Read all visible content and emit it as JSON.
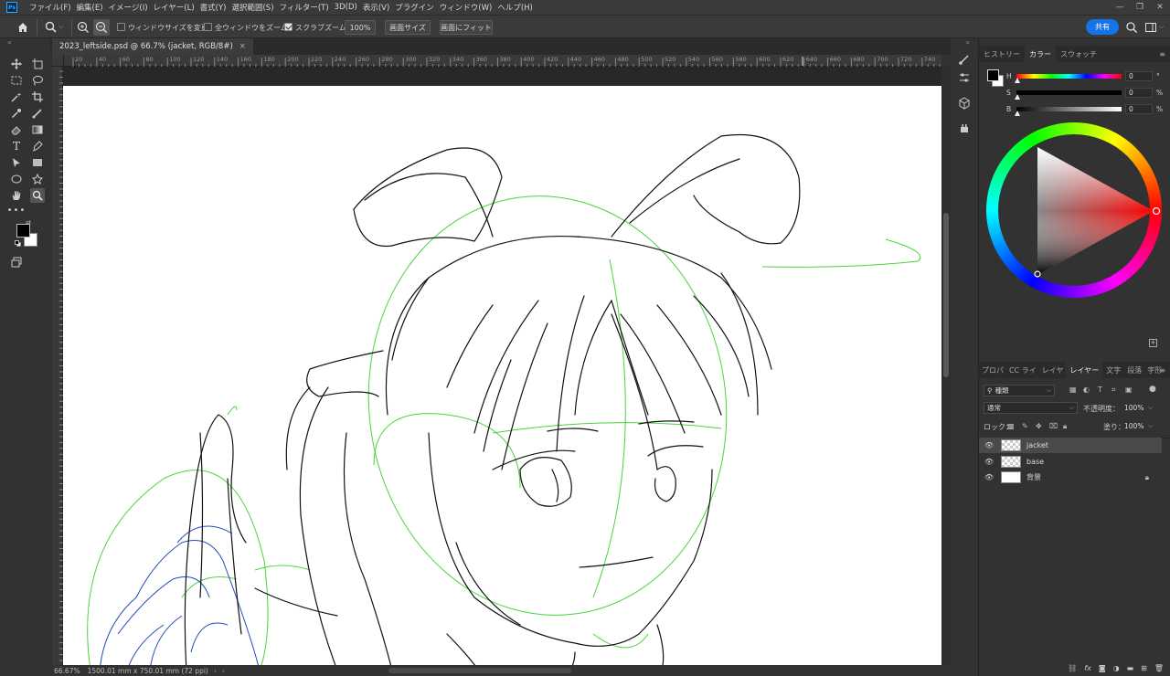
{
  "app": {
    "logo_text": "Ps"
  },
  "menubar": {
    "items": [
      "ファイル(F)",
      "編集(E)",
      "イメージ(I)",
      "レイヤー(L)",
      "書式(Y)",
      "選択範囲(S)",
      "フィルター(T)",
      "3D(D)",
      "表示(V)",
      "プラグイン",
      "ウィンドウ(W)",
      "ヘルプ(H)"
    ]
  },
  "options_bar": {
    "resize_windows_label": "ウィンドウサイズを変更",
    "resize_windows_checked": false,
    "zoom_all_label": "全ウィンドウをズーム",
    "zoom_all_checked": false,
    "scrubby_zoom_label": "スクラブズーム",
    "scrubby_zoom_checked": true,
    "zoom_value": "100%",
    "fit_screen_label": "画面サイズ",
    "fill_screen_label": "画面にフィット",
    "share_label": "共有"
  },
  "document": {
    "tab_title": "2023_leftside.psd @ 66.7% (jacket, RGB/8#)",
    "close_glyph": "×"
  },
  "ruler": {
    "h_ticks": [
      "20",
      "40",
      "60",
      "80",
      "100",
      "120",
      "140",
      "160",
      "180",
      "200",
      "220",
      "240",
      "260",
      "280",
      "300",
      "320",
      "340",
      "360",
      "380",
      "400",
      "420",
      "440",
      "460",
      "480",
      "500",
      "520",
      "540",
      "560",
      "580",
      "600",
      "620",
      "640",
      "660",
      "680",
      "700",
      "720",
      "740"
    ]
  },
  "status": {
    "zoom": "66.67%",
    "doc_size": "1500.01 mm x 750.01 mm (72 ppi)"
  },
  "color_panel": {
    "tabs": [
      "ヒストリー",
      "カラー",
      "スウォッチ"
    ],
    "active_tab": "カラー",
    "h_label": "H",
    "h_value": "0",
    "h_unit": "°",
    "s_label": "S",
    "s_value": "0",
    "s_unit": "%",
    "b_label": "B",
    "b_value": "0",
    "b_unit": "%",
    "foreground": "#000000",
    "background": "#ffffff"
  },
  "layers_panel": {
    "tabs": [
      "プロパ",
      "CC ライ",
      "レイヤ",
      "レイヤー",
      "文字",
      "段落",
      "字形"
    ],
    "active_tab": "レイヤー",
    "filter_label": "種類",
    "blend_mode": "通常",
    "opacity_label": "不透明度：",
    "opacity_value": "100%",
    "lock_label": "ロック：",
    "fill_label": "塗り：",
    "fill_value": "100%",
    "layers": [
      {
        "name": "jacket",
        "visible": true,
        "selected": true,
        "locked": false
      },
      {
        "name": "base",
        "visible": true,
        "selected": false,
        "locked": false
      },
      {
        "name": "背景",
        "visible": true,
        "selected": false,
        "locked": true
      }
    ]
  }
}
